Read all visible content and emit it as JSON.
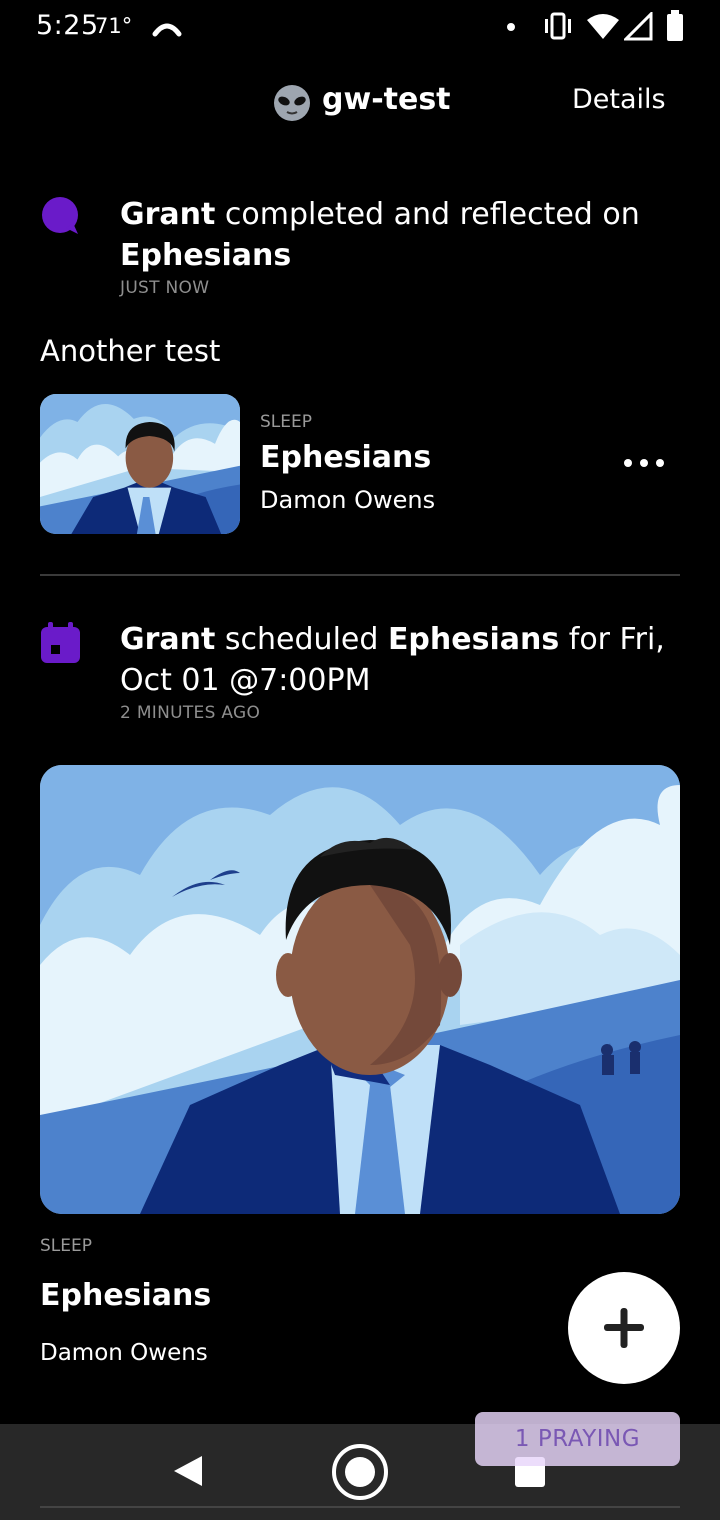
{
  "status_bar": {
    "time": "5:25",
    "temperature": "71°",
    "icons": [
      "weather-icon",
      "notification-dot-icon",
      "vibrate-icon",
      "wifi-icon",
      "signal-icon",
      "battery-icon"
    ]
  },
  "header": {
    "emoji_icon": "alien-icon",
    "title": "gw-test",
    "details_label": "Details"
  },
  "activity_1": {
    "icon": "chat-bubble-icon",
    "icon_color": "#6a1bc9",
    "actor": "Grant",
    "text_middle": " completed and reflected on ",
    "subject": "Ephesians",
    "time": "JUST NOW"
  },
  "section_title": "Another test",
  "card": {
    "category": "SLEEP",
    "title": "Ephesians",
    "author": "Damon Owens",
    "more_icon": "more-horizontal-icon"
  },
  "activity_2": {
    "icon": "calendar-icon",
    "icon_color": "#6a1bc9",
    "actor": "Grant",
    "text_middle": " scheduled ",
    "subject": "Ephesians",
    "text_end": " for Fri, Oct 01 @7:00PM",
    "time": "2 MINUTES AGO"
  },
  "hero": {
    "category": "SLEEP",
    "title": "Ephesians",
    "author": "Damon Owens"
  },
  "fab": {
    "icon": "plus-icon"
  },
  "praying_label": "1 PRAYING",
  "nav": {
    "back_icon": "back-icon",
    "home_icon": "home-icon",
    "recents_icon": "recents-icon"
  },
  "colors": {
    "accent": "#6a1bc9",
    "sky": "#a9d3f0",
    "suit": "#0d2a78"
  }
}
